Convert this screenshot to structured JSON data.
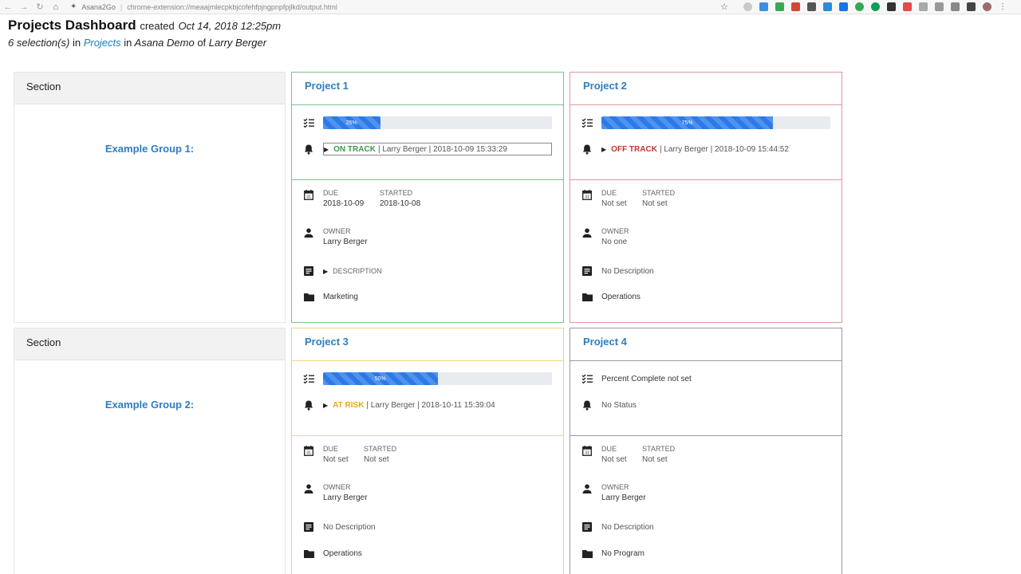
{
  "browser": {
    "tab_label": "Asana2Go",
    "url": "chrome-extension://meaajmlecpkbjcofehfpjngpnpfpjlkd/output.html"
  },
  "header": {
    "title": "Projects Dashboard",
    "created_label": "created",
    "created_date": "Oct 14, 2018 12:25pm",
    "selection_count": "6 selection(s)",
    "in_word_1": "in",
    "projects_link": "Projects",
    "in_word_2": "in",
    "workspace": "Asana Demo",
    "of_word": "of",
    "user": "Larry Berger"
  },
  "colors": {
    "on_track": "#3c9a4a",
    "off_track": "#c0392b",
    "at_risk": "#e5a82a",
    "link": "#2d7ec0",
    "progress": "#2b7ae8"
  },
  "sections": [
    {
      "head": "Section",
      "group": "Example Group 1:",
      "projects": [
        {
          "name": "Project 1",
          "border_color": "#7cc18c",
          "progress_percent": 25,
          "progress_label": "25%",
          "status_word": "ON TRACK",
          "status_color": "#3c9a4a",
          "status_detail": "| Larry Berger | 2018-10-09 15:33:29",
          "due_label": "DUE",
          "due": "2018-10-09",
          "started_label": "STARTED",
          "started": "2018-10-08",
          "owner_label": "OWNER",
          "owner": "Larry Berger",
          "description": "DESCRIPTION",
          "program": "Marketing"
        },
        {
          "name": "Project 2",
          "border_color": "#dd9aa0",
          "progress_percent": 75,
          "progress_label": "75%",
          "status_word": "OFF TRACK",
          "status_color": "#c0392b",
          "status_detail": "| Larry Berger | 2018-10-09 15:44:52",
          "due_label": "DUE",
          "due": "Not set",
          "started_label": "STARTED",
          "started": "Not set",
          "owner_label": "OWNER",
          "owner": "No one",
          "description": "No Description",
          "program": "Operations"
        }
      ]
    },
    {
      "head": "Section",
      "group": "Example Group 2:",
      "projects": [
        {
          "name": "Project 3",
          "border_color": "#f2d47a",
          "progress_percent": 50,
          "progress_label": "50%",
          "status_word": "AT RISK",
          "status_color": "#e5a82a",
          "status_detail": "| Larry Berger | 2018-10-11 15:39:04",
          "due_label": "DUE",
          "due": "Not set",
          "started_label": "STARTED",
          "started": "Not set",
          "owner_label": "OWNER",
          "owner": "Larry Berger",
          "description": "No Description",
          "program": "Operations"
        },
        {
          "name": "Project 4",
          "border_color": "#9a9a9a",
          "percent_text": "Percent Complete not set",
          "status_text": "No Status",
          "due_label": "DUE",
          "due": "Not set",
          "started_label": "STARTED",
          "started": "Not set",
          "owner_label": "OWNER",
          "owner": "Larry Berger",
          "description": "No Description",
          "program": "No Program"
        }
      ]
    }
  ]
}
